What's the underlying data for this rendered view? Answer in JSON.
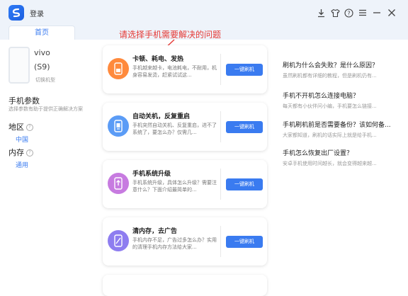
{
  "titlebar": {
    "login": "登录",
    "icons": [
      "download-icon",
      "shirt-icon",
      "help-icon",
      "menu-icon",
      "minimize-icon",
      "close-icon"
    ],
    "accent": "#3a7bf0"
  },
  "tabs": {
    "home": "首页"
  },
  "device": {
    "brand": "vivo",
    "model": "(S9)",
    "switch": "切换机型"
  },
  "params": {
    "title": "手机参数",
    "desc": "选择参数有助于提供正确解决方案",
    "region_label": "地区",
    "region_value": "中国",
    "memory_label": "内存",
    "memory_value": "通用"
  },
  "annotation": "请选择手机需要解决的问题",
  "cards": [
    {
      "title": "卡顿、耗电、发热",
      "desc": "手机越来越卡，电池耗电，不耐用，机身容易发烫，赶紧试试这...",
      "button": "一键刷机",
      "icon": "phone-heat-icon",
      "color": "#ff8a3d"
    },
    {
      "title": "自动关机，反复重启",
      "desc": "手机突然自动关机、反复重启，进不了系统了，要怎么办？仅需几...",
      "button": "一键刷机",
      "icon": "phone-restart-icon",
      "color": "#5b9cf6"
    },
    {
      "title": "手机系统升级",
      "desc": "手机系统升级，具体怎么升级？需要注意什么？下面介绍最简单的...",
      "button": "一键刷机",
      "icon": "phone-upgrade-icon",
      "color": "#c77be0"
    },
    {
      "title": "清内存，去广告",
      "desc": "手机内存不足，广告过多怎么办？实用的清理手机内存方法给大家...",
      "button": "一键刷机",
      "icon": "phone-clean-icon",
      "color": "#8e7df0"
    }
  ],
  "articles": [
    {
      "title": "刷机为什么会失败？是什么原因？",
      "desc": "虽然刷机都有详细的教程，但是刷机仍有..."
    },
    {
      "title": "手机不开机怎么连接电脑？",
      "desc": "每天都有小伙伴问小编，手机要怎么链接..."
    },
    {
      "title": "手机刷机前是否需要备份？该如何备...",
      "desc": "大家都知道，刷机的话实际上就是给手机..."
    },
    {
      "title": "手机怎么恢复出厂设置？",
      "desc": "安卓手机使用时间越长，就会变得越来越..."
    }
  ]
}
